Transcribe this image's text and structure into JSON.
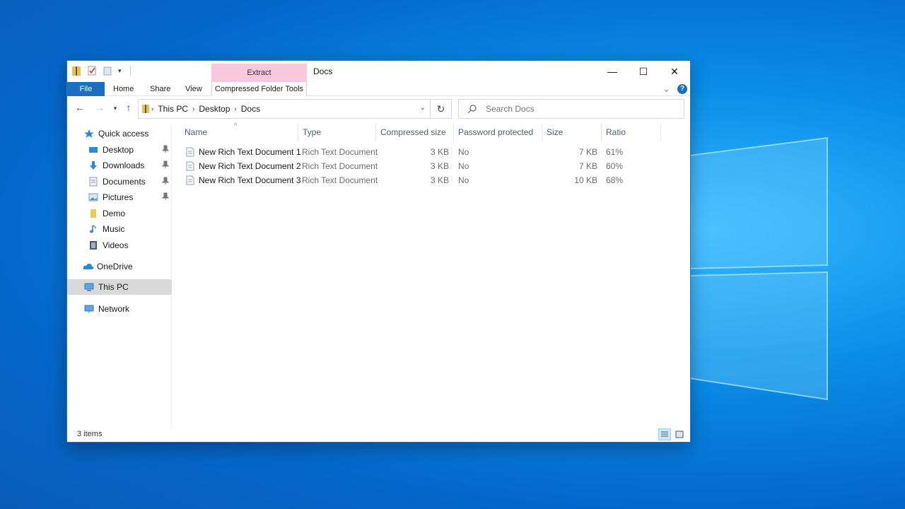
{
  "window": {
    "title": "Docs",
    "contextual_tab": "Extract",
    "minimize": "—",
    "maximize": "☐",
    "close": "✕"
  },
  "ribbon": {
    "tabs": [
      "File",
      "Home",
      "Share",
      "View",
      "Compressed Folder Tools"
    ],
    "collapse": "⌄",
    "help": "?"
  },
  "address": {
    "crumbs": [
      "This PC",
      "Desktop",
      "Docs"
    ],
    "refresh": "↻"
  },
  "search": {
    "placeholder": "Search Docs"
  },
  "nav": {
    "quick_access": "Quick access",
    "items": [
      "Desktop",
      "Downloads",
      "Documents",
      "Pictures",
      "Demo",
      "Music",
      "Videos"
    ],
    "onedrive": "OneDrive",
    "this_pc": "This PC",
    "network": "Network"
  },
  "columns": [
    "Name",
    "Type",
    "Compressed size",
    "Password protected",
    "Size",
    "Ratio"
  ],
  "files": [
    {
      "name": "New Rich Text Document 1",
      "type": "Rich Text Document",
      "compressed": "3 KB",
      "password": "No",
      "size": "7 KB",
      "ratio": "61%"
    },
    {
      "name": "New Rich Text Document 2",
      "type": "Rich Text Document",
      "compressed": "3 KB",
      "password": "No",
      "size": "7 KB",
      "ratio": "60%"
    },
    {
      "name": "New Rich Text Document 3",
      "type": "Rich Text Document",
      "compressed": "3 KB",
      "password": "No",
      "size": "10 KB",
      "ratio": "68%"
    }
  ],
  "status": {
    "count": "3 items"
  },
  "colors": {
    "accent": "#1a6fc1",
    "extract_tab": "#f9c8dc",
    "selected": "#d9d9d9"
  }
}
